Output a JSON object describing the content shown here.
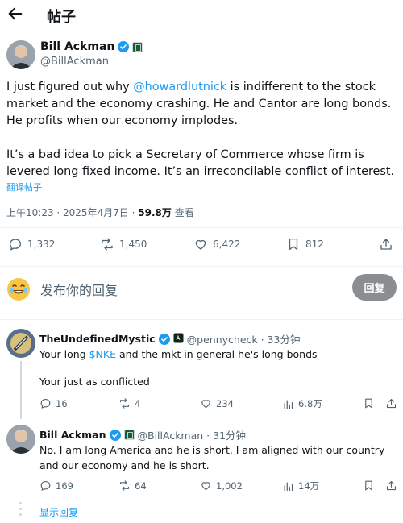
{
  "header": {
    "title": "帖子"
  },
  "tweet": {
    "author_name": "Bill Ackman",
    "author_handle": "@BillAckman",
    "text_line1_pre": "I just figured out why ",
    "mention": "@howardlutnick",
    "text_line1_post": " is indifferent to the stock market and the economy crashing. He and Cantor are long bonds. He profits when our economy implodes.",
    "text_para2": "It’s a bad idea to pick a Secretary of Commerce whose firm is levered long fixed income. It’s an irreconcilable conflict of interest.",
    "translate_label": "翻译帖子",
    "timestamp": "上午10:23 · 2025年4月7日 · ",
    "views_value": "59.8万",
    "views_label": " 查看",
    "stats": {
      "replies": "1,332",
      "reposts": "1,450",
      "likes": "6,422",
      "bookmarks": "812"
    }
  },
  "composer": {
    "placeholder": "发布你的回复",
    "reply_button": "回复"
  },
  "replies": [
    {
      "name": "TheUndefinedMystic",
      "handle": "@pennycheck · 33分钟",
      "text_pre": "Your long ",
      "cashtag": "$NKE",
      "text_post": " and the mkt in general  he's long bonds",
      "text_line2": "Your just as conflicted",
      "stats": {
        "replies": "16",
        "reposts": "4",
        "likes": "234",
        "views": "6.8万"
      }
    },
    {
      "name": "Bill Ackman",
      "handle": "@BillAckman · 31分钟",
      "text": "No. I am long America and he is short. I am aligned with our country and our economy and he is short.",
      "stats": {
        "replies": "169",
        "reposts": "64",
        "likes": "1,002",
        "views": "14万"
      }
    }
  ],
  "show_replies": "显示回复",
  "colors": {
    "accent": "#1d9bf0",
    "muted": "#536471",
    "text": "#0f1419",
    "reply_button_bg": "#8a8e91"
  },
  "icons": [
    "back-arrow-icon",
    "verified-badge-icon",
    "affiliate-badge-icon",
    "reply-icon",
    "repost-icon",
    "like-icon",
    "views-icon",
    "bookmark-icon",
    "share-icon",
    "emoji-icon"
  ]
}
